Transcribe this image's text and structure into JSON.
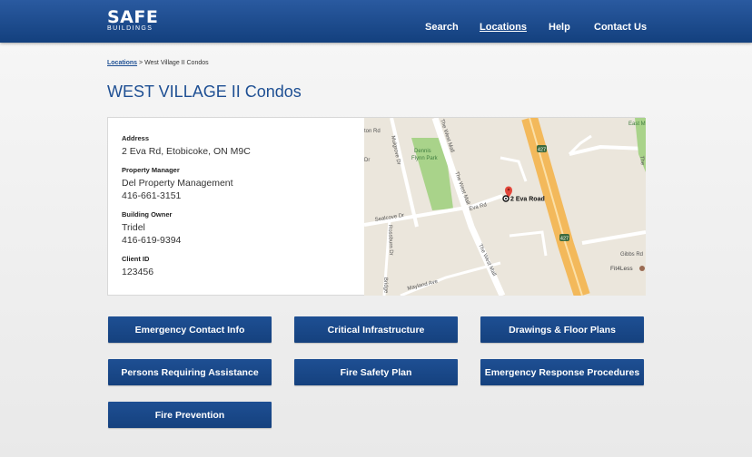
{
  "header": {
    "logo_main": "SAFE",
    "logo_sub": "BUILDINGS",
    "nav": [
      "Search",
      "Locations",
      "Help",
      "Contact Us"
    ]
  },
  "breadcrumb": {
    "link": "Locations",
    "separator": ">",
    "current": "West Village II Condos"
  },
  "page_title": "WEST VILLAGE II Condos",
  "details": {
    "address_label": "Address",
    "address": "2 Eva Rd, Etobicoke, ON M9C",
    "manager_label": "Property Manager",
    "manager_name": "Del Property Management",
    "manager_phone": "416-661-3151",
    "owner_label": "Building Owner",
    "owner_name": "Tridel",
    "owner_phone": "416-619-9394",
    "client_label": "Client ID",
    "client_id": "123456"
  },
  "map": {
    "pin_label": "2 Eva Road",
    "park_name_1": "Dennis",
    "park_name_2": "Flynn Park",
    "street_west_mall": "The West Mall",
    "street_eva": "Eva Rd",
    "street_sealcove": "Sealcove Dr",
    "street_mulgrove": "Mulgrove Dr",
    "street_rossburn": "Rossburn Dr",
    "street_mayland": "Mayland Ave",
    "street_gibbs": "Gibbs Rd",
    "street_bridge": "Bridge",
    "street_ton": "ton Rd",
    "street_dr": "Dr",
    "highway_shield": "427",
    "poi_east": "East M",
    "poi_fit4less": "Fit4Less",
    "poi_ta": "The"
  },
  "buttons": [
    "Emergency Contact Info",
    "Critical Infrastructure",
    "Drawings & Floor Plans",
    "Persons Requiring Assistance",
    "Fire Safety Plan",
    "Emergency Response Procedures",
    "Fire Prevention"
  ],
  "colors": {
    "brand_blue": "#1e4f93",
    "header_gradient_top": "#2a5aa0",
    "header_gradient_bottom": "#13407e",
    "map_park": "#a9d38a",
    "map_highway": "#f3b95b"
  }
}
